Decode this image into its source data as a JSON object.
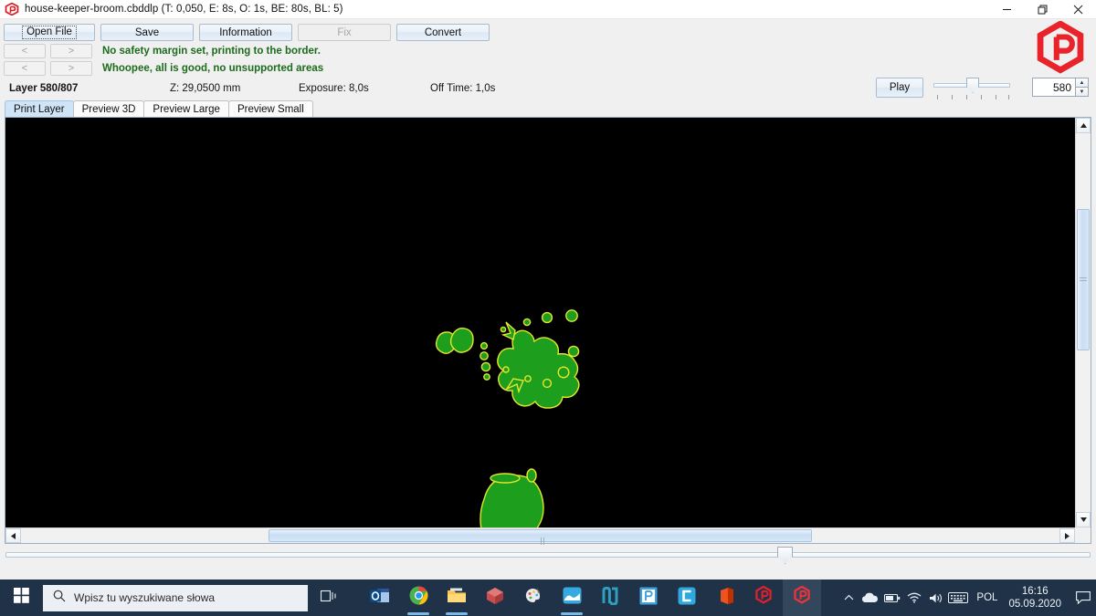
{
  "window": {
    "title": "house-keeper-broom.cbddlp (T: 0,050, E: 8s, O: 1s, BE: 80s, BL: 5)",
    "app_logo": "uvtools-hex-p-logo",
    "controls": {
      "minimize": "minimize-icon",
      "restore": "restore-icon",
      "close": "close-icon"
    }
  },
  "toolbar": {
    "buttons": [
      {
        "label": "Open File",
        "name": "open-file-button",
        "disabled": false,
        "focused": true
      },
      {
        "label": "Save",
        "name": "save-button",
        "disabled": false,
        "focused": false
      },
      {
        "label": "Information",
        "name": "information-button",
        "disabled": false,
        "focused": false
      },
      {
        "label": "Fix",
        "name": "fix-button",
        "disabled": true,
        "focused": false
      },
      {
        "label": "Convert",
        "name": "convert-button",
        "disabled": false,
        "focused": false
      }
    ],
    "nav_prev": "<",
    "nav_next": ">",
    "messages": [
      "No safety margin set, printing to the border.",
      "Whoopee, all is good, no unsupported areas"
    ],
    "message_color": "#1d6b1d"
  },
  "status": {
    "layer": "Layer 580/807",
    "z": "Z: 29,0500 mm",
    "exposure": "Exposure: 8,0s",
    "off_time": "Off Time: 1,0s",
    "play_label": "Play",
    "layer_value": "580",
    "spin_up": "▲",
    "spin_down": "▼"
  },
  "tabs": [
    {
      "label": "Print Layer",
      "active": true
    },
    {
      "label": "Preview 3D",
      "active": false
    },
    {
      "label": "Preview Large",
      "active": false
    },
    {
      "label": "Preview Small",
      "active": false
    }
  ],
  "canvas": {
    "background": "#000000",
    "fill_color": "#1d9e1d",
    "edge_color": "#e6e62c",
    "scroll": {
      "up_arrow": "▲",
      "down_arrow": "▼",
      "left_arrow": "◄",
      "right_arrow": "►"
    }
  },
  "taskbar": {
    "start": "windows-start-icon",
    "search_placeholder": "Wpisz tu wyszukiwane słowa",
    "task_view": "task-view-icon",
    "apps": [
      {
        "name": "outlook",
        "active": false,
        "underline": false
      },
      {
        "name": "google-chrome",
        "active": false,
        "underline": true
      },
      {
        "name": "file-explorer",
        "active": false,
        "underline": true
      },
      {
        "name": "3d-viewer",
        "active": false,
        "underline": false
      },
      {
        "name": "paint-3d",
        "active": false,
        "underline": false
      },
      {
        "name": "photos",
        "active": false,
        "underline": true
      },
      {
        "name": "prusa-slicer",
        "active": false,
        "underline": false
      },
      {
        "name": "project-app",
        "active": false,
        "underline": false
      },
      {
        "name": "chitubox",
        "active": false,
        "underline": false
      },
      {
        "name": "office",
        "active": false,
        "underline": false
      },
      {
        "name": "uvtools",
        "active": false,
        "underline": false
      },
      {
        "name": "uvtools-active",
        "active": true,
        "underline": false
      }
    ],
    "tray": {
      "chevron": "chevron-up-icon",
      "onedrive": "cloud-icon",
      "battery": "battery-icon",
      "wifi": "wifi-icon",
      "volume": "volume-icon",
      "keyboard": "keyboard-icon",
      "language": "POL",
      "time": "16:16",
      "date": "05.09.2020",
      "action_center": "action-center-icon"
    }
  }
}
